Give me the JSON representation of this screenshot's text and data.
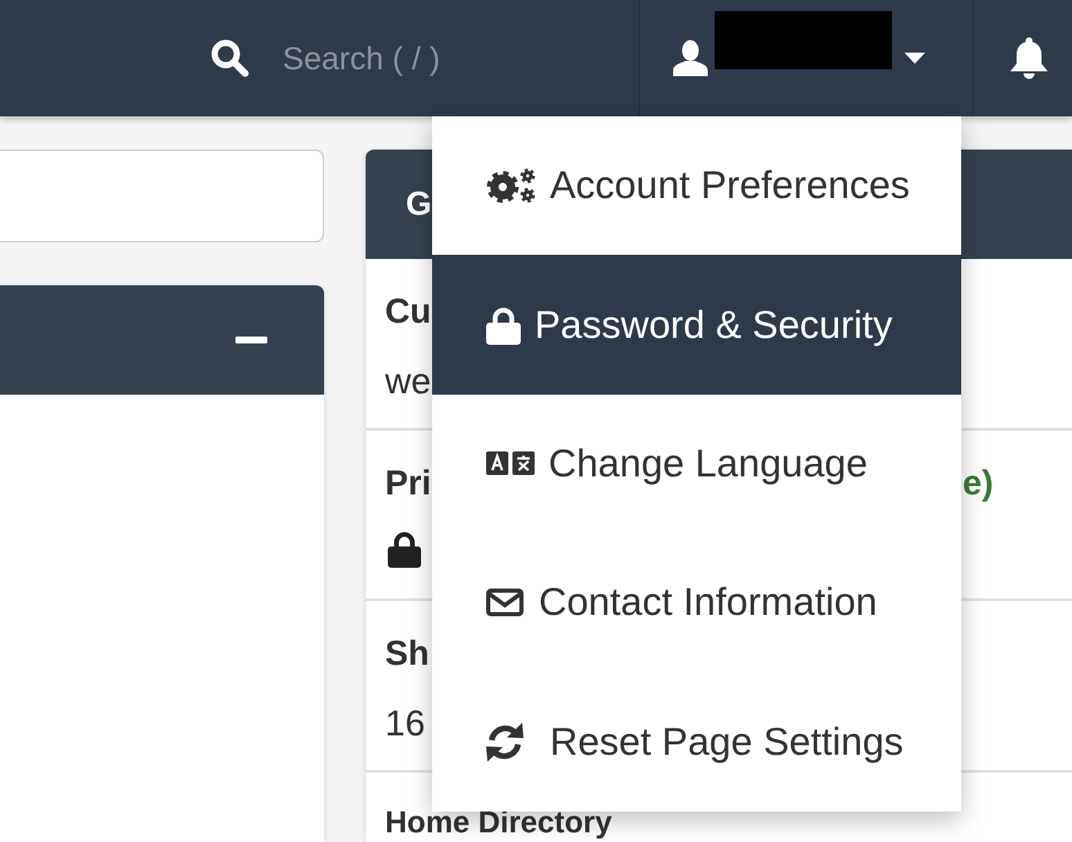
{
  "top_bar": {
    "search": {
      "placeholder": "Search ( / )"
    },
    "user_menu": {
      "expanded": true,
      "items": [
        {
          "label": "Account Preferences",
          "selected": false
        },
        {
          "label": "Password & Security",
          "selected": true
        },
        {
          "label": "Change Language",
          "selected": false
        },
        {
          "label": "Contact Information",
          "selected": false
        },
        {
          "label": "Reset Page Settings",
          "selected": false
        }
      ]
    }
  },
  "right_panel": {
    "title": "G",
    "rows": [
      {
        "kind": "text",
        "label": "Cu",
        "value": "we"
      },
      {
        "kind": "locked",
        "label": "Pri",
        "action": "e)"
      },
      {
        "kind": "text",
        "label": "Sh",
        "value": "16"
      },
      {
        "kind": "text",
        "label": "Home Directory"
      }
    ]
  }
}
